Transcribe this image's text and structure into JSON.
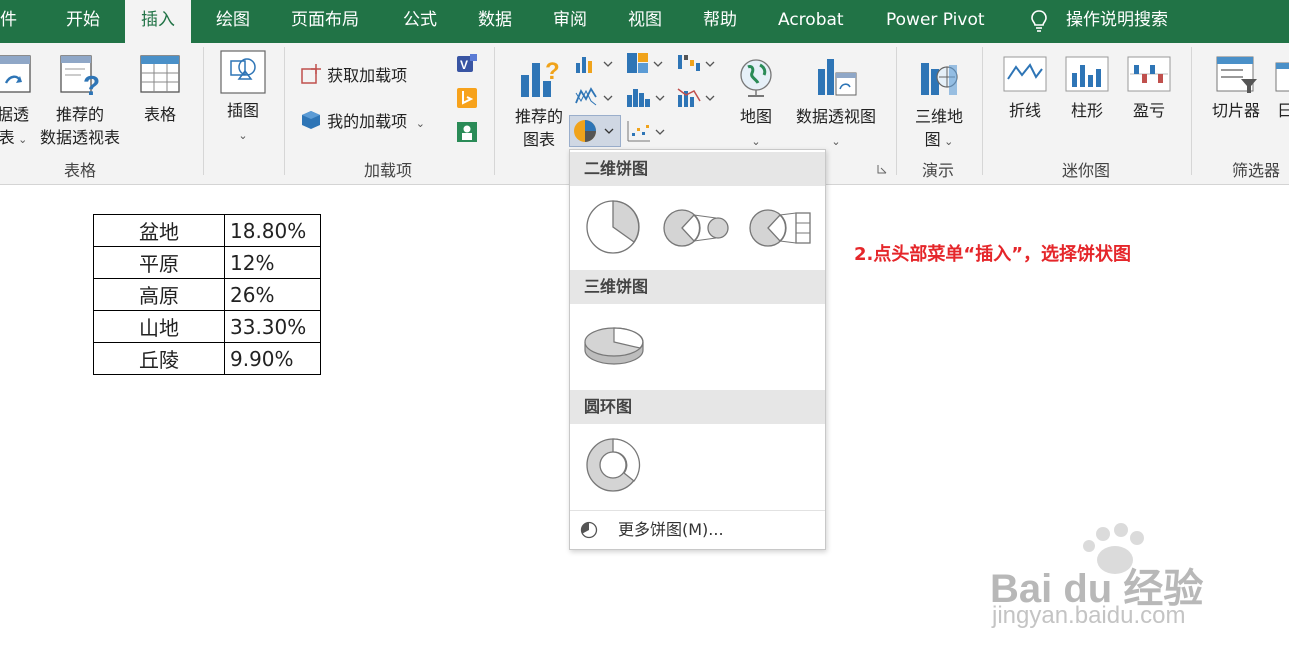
{
  "tabs": [
    "文件",
    "开始",
    "插入",
    "绘图",
    "页面布局",
    "公式",
    "数据",
    "审阅",
    "视图",
    "帮助",
    "Acrobat",
    "Power Pivot"
  ],
  "tabs_visible": [
    "件",
    "开始",
    "插入",
    "绘图",
    "页面布局",
    "公式",
    "数据",
    "审阅",
    "视图",
    "帮助",
    "Acrobat",
    "Power Pivot"
  ],
  "active_tab": "插入",
  "tell_me": "操作说明搜索",
  "ribbon": {
    "tables_group": {
      "label": "表格",
      "pivot_line1": "据透",
      "pivot_line2": "表",
      "recommended_line1": "推荐的",
      "recommended_line2": "数据透视表",
      "table": "表格"
    },
    "illustrations": {
      "label": "插图"
    },
    "addins_group": {
      "label": "加载项",
      "get_addins": "获取加载项",
      "my_addins": "我的加载项"
    },
    "charts_group": {
      "recommended_line1": "推荐的",
      "recommended_line2": "图表",
      "maps": "地图",
      "pivot_chart": "数据透视图"
    },
    "tours_group": {
      "label": "演示",
      "map3d_line1": "三维地",
      "map3d_line2": "图"
    },
    "sparklines_group": {
      "label": "迷你图",
      "line": "折线",
      "column": "柱形",
      "win_loss": "盈亏"
    },
    "filters_group": {
      "label": "筛选器",
      "slicer": "切片器",
      "timeline": "日"
    }
  },
  "pie_dropdown": {
    "section_2d": "二维饼图",
    "section_3d": "三维饼图",
    "section_doughnut": "圆环图",
    "more": "更多饼图(M)..."
  },
  "table_rows": [
    {
      "name": "盆地",
      "value": "18.80%"
    },
    {
      "name": "平原",
      "value": "12%"
    },
    {
      "name": "高原",
      "value": "26%"
    },
    {
      "name": "山地",
      "value": "33.30%"
    },
    {
      "name": "丘陵",
      "value": "9.90%"
    }
  ],
  "annotation": "2.点头部菜单“插入”，选择饼状图",
  "watermark": {
    "brand": "Bai du 经验",
    "url": "jingyan.baidu.com"
  },
  "colors": {
    "excel_green": "#217346",
    "annotation_red": "#e5262a"
  }
}
